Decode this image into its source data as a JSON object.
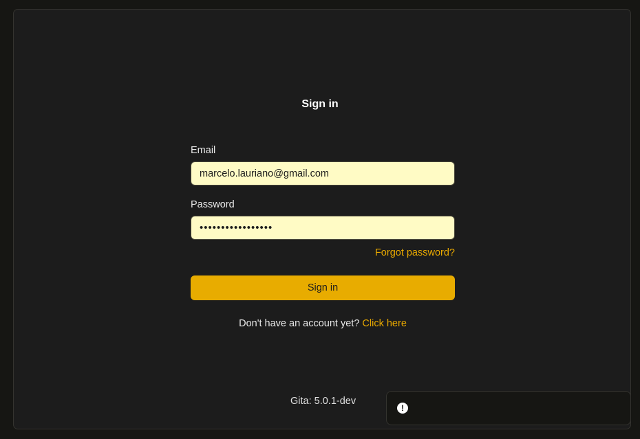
{
  "login": {
    "title": "Sign in",
    "email_label": "Email",
    "email_value": "marcelo.lauriano@gmail.com",
    "password_label": "Password",
    "password_value": "•••••••••••••••••",
    "forgot_label": "Forgot password?",
    "submit_label": "Sign in",
    "signup_text": "Don't have an account yet?",
    "signup_link": "Click here"
  },
  "footer": {
    "version": "Gita: 5.0.1-dev"
  },
  "toast": {
    "icon": "exclamation-circle-icon",
    "icon_glyph": "!"
  },
  "colors": {
    "accent": "#e8ac00",
    "link": "#e8a800",
    "input_bg": "#fffbc5",
    "panel_bg": "#1c1c1c",
    "page_bg": "#161613"
  }
}
